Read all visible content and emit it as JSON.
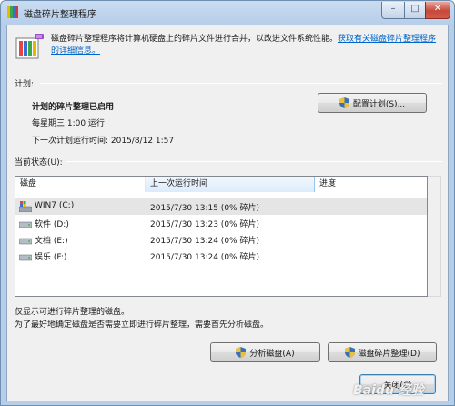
{
  "window": {
    "title": "磁盘碎片整理程序",
    "min_glyph": "–",
    "max_glyph": "□",
    "close_glyph": "✕"
  },
  "intro": {
    "text": "磁盘碎片整理程序将计算机硬盘上的碎片文件进行合并，以改进文件系统性能。",
    "link": "获取有关磁盘碎片整理程序的详细信息。"
  },
  "schedule": {
    "section_label": "计划:",
    "status": "计划的碎片整理已启用",
    "frequency": "每星期三  1:00 运行",
    "next_run": "下一次计划运行时间: 2015/8/12 1:57",
    "configure_button": "配置计划(S)..."
  },
  "current_status": {
    "section_label": "当前状态(U):",
    "columns": [
      "磁盘",
      "上一次运行时间",
      "进度"
    ],
    "rows": [
      {
        "disk": "WIN7 (C:)",
        "last_run": "2015/7/30 13:15 (0% 碎片)",
        "progress": ""
      },
      {
        "disk": "软件 (D:)",
        "last_run": "2015/7/30 13:23 (0% 碎片)",
        "progress": ""
      },
      {
        "disk": "文档 (E:)",
        "last_run": "2015/7/30 13:24 (0% 碎片)",
        "progress": ""
      },
      {
        "disk": "娱乐 (F:)",
        "last_run": "2015/7/30 13:24 (0% 碎片)",
        "progress": ""
      }
    ]
  },
  "footer": {
    "note1": "仅显示可进行碎片整理的磁盘。",
    "note2": "为了最好地确定磁盘是否需要立即进行碎片整理，需要首先分析磁盘。",
    "analyze_button": "分析磁盘(A)",
    "defrag_button": "磁盘碎片整理(D)",
    "close_button": "关闭(C)"
  },
  "watermark": "Baidu 经验",
  "colors": {
    "accent_link": "#0066cc",
    "title_bar": "#b7cee9",
    "selected_row": "#e5e5e5"
  }
}
